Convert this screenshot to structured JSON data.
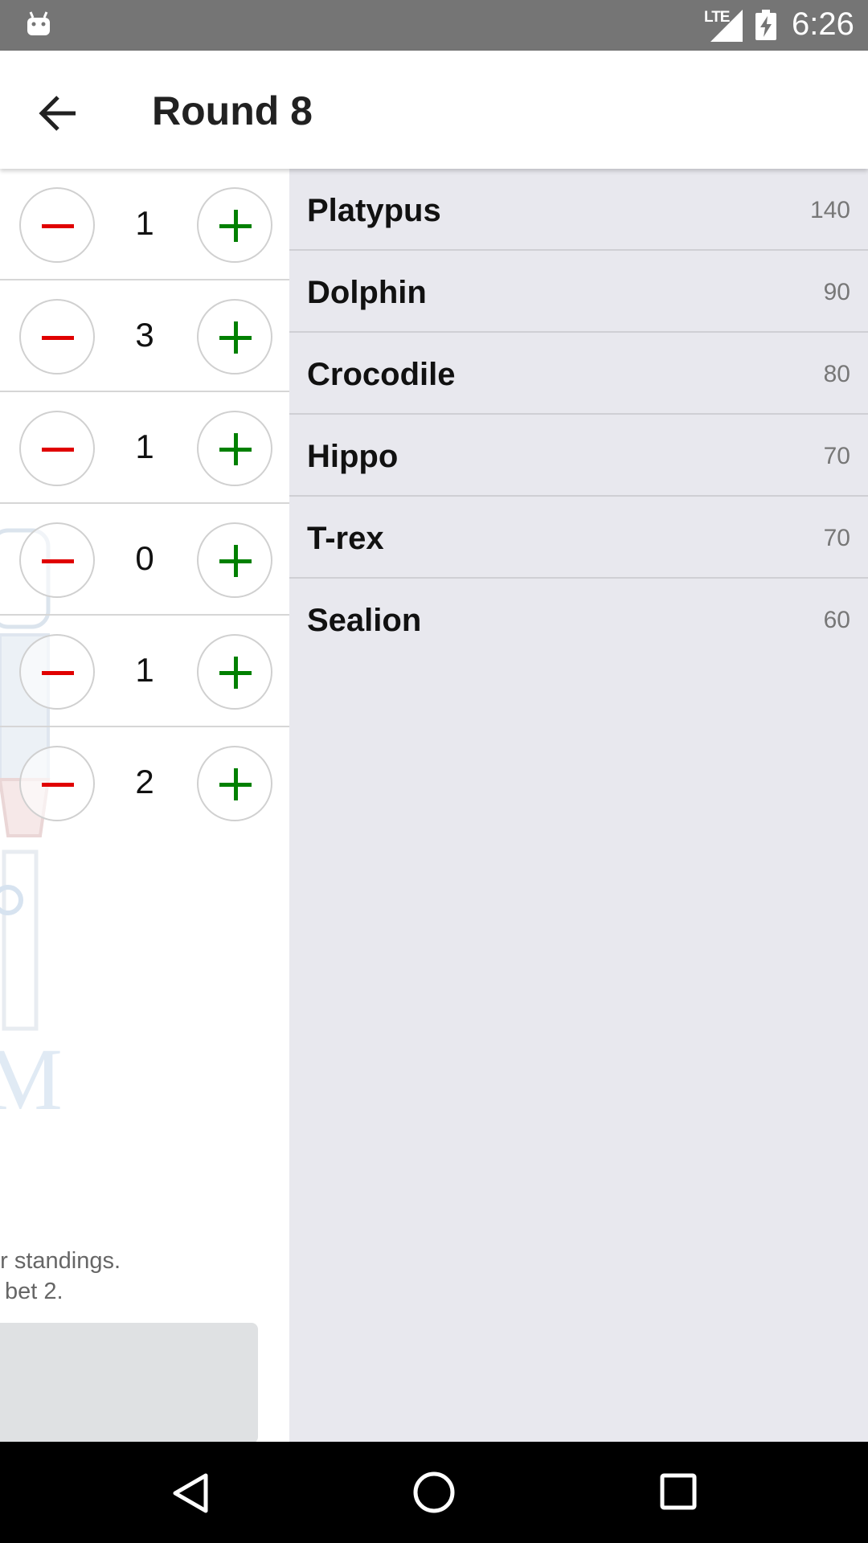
{
  "status_bar": {
    "network": "LTE",
    "time": "6:26"
  },
  "app_bar": {
    "title": "Round 8",
    "back_icon": "arrow-back-icon"
  },
  "bets": [
    {
      "value": "1"
    },
    {
      "value": "3"
    },
    {
      "value": "1"
    },
    {
      "value": "0"
    },
    {
      "value": "1"
    },
    {
      "value": "2"
    }
  ],
  "hint": {
    "line1": "er standings.",
    "line2": "bet 2."
  },
  "standings": [
    {
      "name": "Platypus",
      "score": "140"
    },
    {
      "name": "Dolphin",
      "score": "90"
    },
    {
      "name": "Crocodile",
      "score": "80"
    },
    {
      "name": "Hippo",
      "score": "70"
    },
    {
      "name": "T-rex",
      "score": "70"
    },
    {
      "name": "Sealion",
      "score": "60"
    }
  ],
  "colors": {
    "minus": "#e00000",
    "plus": "#008000",
    "standings_bg": "#e8e8ee",
    "status_bar": "#757575"
  }
}
